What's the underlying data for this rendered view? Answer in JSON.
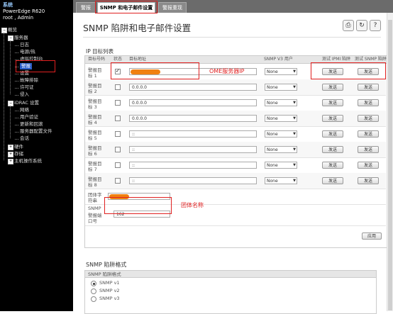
{
  "sidebar": {
    "system_label": "系统",
    "model": "PowerEdge R620",
    "user": "root , Admin",
    "tree": [
      {
        "label": "概览",
        "box": "−"
      },
      {
        "label": "服务器",
        "box": "−"
      },
      {
        "label": "日志"
      },
      {
        "label": "电源/热"
      },
      {
        "label": "虚拟控制台"
      },
      {
        "label": "警报"
      },
      {
        "label": "设置"
      },
      {
        "label": "故障排除"
      },
      {
        "label": "许可证"
      },
      {
        "label": "侵入"
      },
      {
        "label": "iDRAC 设置",
        "box": "−"
      },
      {
        "label": "网络"
      },
      {
        "label": "用户验证"
      },
      {
        "label": "更新和回滚"
      },
      {
        "label": "服务器配置文件"
      },
      {
        "label": "会话"
      },
      {
        "label": "硬件",
        "box": "+"
      },
      {
        "label": "存储",
        "box": "+"
      },
      {
        "label": "主机操作系统",
        "box": "+"
      }
    ]
  },
  "tabs": [
    {
      "label": "警报"
    },
    {
      "label": "SNMP 和电子邮件设置"
    },
    {
      "label": "警报重现"
    }
  ],
  "page": {
    "title": "SNMP 陷阱和电子邮件设置",
    "icons": [
      "print-icon",
      "refresh-icon",
      "help-icon"
    ]
  },
  "ip_list": {
    "section_title": "IP 目标列表",
    "headers": {
      "target_no": "目标号码",
      "status": "状态",
      "address": "目标地址",
      "snmp_user": "SNMP V3 用户",
      "test_ipmi": "测试 IPMI 陷阱",
      "test_snmp": "测试 SNMP 陷阱"
    },
    "rows": [
      {
        "label1": "警报目",
        "label2": "标 1",
        "checked": true,
        "address": "",
        "user": "None",
        "ipmi_btn": "发送",
        "snmp_btn": "发送"
      },
      {
        "label1": "警报目",
        "label2": "标 2",
        "checked": false,
        "address": "0.0.0.0",
        "user": "None",
        "ipmi_btn": "发送",
        "snmp_btn": "发送"
      },
      {
        "label1": "警报目",
        "label2": "标 3",
        "checked": false,
        "address": "0.0.0.0",
        "user": "None",
        "ipmi_btn": "发送",
        "snmp_btn": "发送"
      },
      {
        "label1": "警报目",
        "label2": "标 4",
        "checked": false,
        "address": "0.0.0.0",
        "user": "None",
        "ipmi_btn": "发送",
        "snmp_btn": "发送"
      },
      {
        "label1": "警报目",
        "label2": "标 5",
        "checked": false,
        "address": "::",
        "user": "None",
        "ipmi_btn": "发送",
        "snmp_btn": "发送"
      },
      {
        "label1": "警报目",
        "label2": "标 6",
        "checked": false,
        "address": "::",
        "user": "None",
        "ipmi_btn": "发送",
        "snmp_btn": "发送"
      },
      {
        "label1": "警报目",
        "label2": "标 7",
        "checked": false,
        "address": "::",
        "user": "None",
        "ipmi_btn": "发送",
        "snmp_btn": "发送"
      },
      {
        "label1": "警报目",
        "label2": "标 8",
        "checked": false,
        "address": "::",
        "user": "None",
        "ipmi_btn": "发送",
        "snmp_btn": "发送"
      }
    ],
    "community": {
      "label1": "团体字",
      "label2": "符串",
      "value": ""
    },
    "port": {
      "label1": "SNMP",
      "label2": "警报端",
      "label3": "口号",
      "value": "162"
    },
    "apply_btn": "应用"
  },
  "annotations": {
    "ome_ip": "OME服务器IP",
    "community_name": "团体名称"
  },
  "snmp_format": {
    "section_title": "SNMP 陷阱格式",
    "header": "SNMP 陷阱格式",
    "options": [
      {
        "label": "SNMP v1",
        "selected": true
      },
      {
        "label": "SNMP v2",
        "selected": false
      },
      {
        "label": "SNMP v3",
        "selected": false
      }
    ]
  },
  "colors": {
    "annotation_red": "#e02020",
    "redacted_orange": "#f08010",
    "selected_blue": "#2a5dc6"
  }
}
